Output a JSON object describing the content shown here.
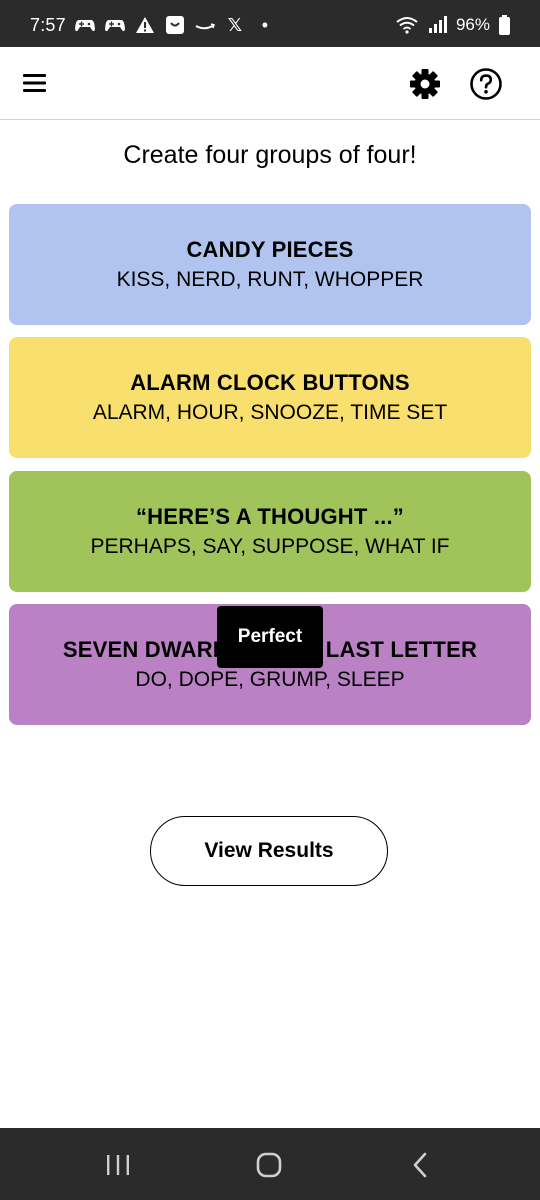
{
  "status_bar": {
    "time": "7:57",
    "battery": "96%",
    "x_glyph": "𝕏",
    "dot_glyph": "•",
    "icons": [
      "game-controller-icon",
      "game-controller-icon",
      "warning-icon",
      "shopping-bag-icon",
      "amazon-icon",
      "x-icon",
      "dot-icon",
      "wifi-icon",
      "signal-icon",
      "battery-icon"
    ]
  },
  "header": {
    "menu_icon": "hamburger-icon",
    "settings_icon": "gear-icon",
    "help_icon": "help-circle-icon"
  },
  "instructions": "Create four groups of four!",
  "groups": [
    {
      "title": "CANDY PIECES",
      "members": "KISS, NERD, RUNT, WHOPPER",
      "color": "#b0c4ef"
    },
    {
      "title": "ALARM CLOCK BUTTONS",
      "members": "ALARM, HOUR, SNOOZE, TIME SET",
      "color": "#f9df6d"
    },
    {
      "title": "“HERE’S A THOUGHT ...”",
      "members": "PERHAPS, SAY, SUPPOSE, WHAT IF",
      "color": "#a0c35a"
    },
    {
      "title": "SEVEN DWARFS MINUS LAST LETTER",
      "members": "DO, DOPE, GRUMP, SLEEP",
      "color": "#ba81c5"
    }
  ],
  "toast": "Perfect",
  "view_results_label": "View Results",
  "nav_bar": {
    "icons": [
      "recents-icon",
      "home-icon",
      "back-icon"
    ]
  }
}
